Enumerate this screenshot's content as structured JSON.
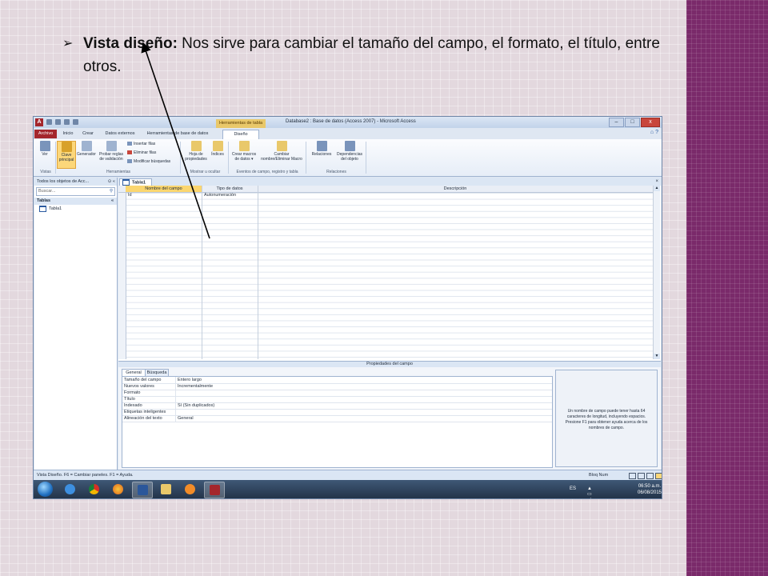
{
  "slide": {
    "bullet_symbol": "➢",
    "bullet_bold": "Vista diseño:",
    "bullet_text": " Nos sirve para cambiar el tamaño del campo, el formato, el título, entre otros."
  },
  "window": {
    "title": "Database2 : Base de datos (Access 2007) - Microsoft Access",
    "context_tab": "Herramientas de tabla",
    "app_icon": "A",
    "buttons": [
      "–",
      "□",
      "x"
    ]
  },
  "tabs": [
    "Archivo",
    "Inicio",
    "Crear",
    "Datos externos",
    "Herramientas de base de datos",
    "Diseño"
  ],
  "ribbon": {
    "ver": "Ver",
    "clave_principal": "Clave principal",
    "generador": "Generador",
    "probar_reglas": "Probar reglas de validación",
    "insertar_filas": "Insertar filas",
    "eliminar_filas": "Eliminar filas",
    "modificar_busquedas": "Modificar búsquedas",
    "hoja_propiedades": "Hoja de propiedades",
    "indices": "Índices",
    "crear_macros": "Crear macros de datos ▾",
    "cambiar_nombre": "Cambiar nombre/Eliminar Macro",
    "relaciones": "Relaciones",
    "dependencias": "Dependencias del objeto",
    "groups": [
      "Vistas",
      "Herramientas",
      "Mostrar u ocultar",
      "Eventos de campo, registro y tabla",
      "Relaciones"
    ]
  },
  "nav": {
    "header": "Todos los objetos de Acc...",
    "header_ctrl": "⊙ «",
    "search_placeholder": "Buscar...",
    "group": "Tablas",
    "group_chevron": "«",
    "items": [
      "Tabla1"
    ]
  },
  "document": {
    "tab": "Tabla1",
    "close": "×",
    "columns": [
      "Nombre del campo",
      "Tipo de datos",
      "Descripción"
    ],
    "rows": [
      {
        "name": "Id",
        "type": "Autonumeración",
        "description": ""
      }
    ],
    "key_symbol": "⚷"
  },
  "properties": {
    "title": "Propiedades del campo",
    "tabs": [
      "General",
      "Búsqueda"
    ],
    "rows": [
      {
        "label": "Tamaño del campo",
        "value": "Entero largo"
      },
      {
        "label": "Nuevos valores",
        "value": "Incrementalmente"
      },
      {
        "label": "Formato",
        "value": ""
      },
      {
        "label": "Título",
        "value": ""
      },
      {
        "label": "Indexado",
        "value": "Sí (Sin duplicados)"
      },
      {
        "label": "Etiquetas inteligentes",
        "value": ""
      },
      {
        "label": "Alineación del texto",
        "value": "General"
      }
    ],
    "help": "Un nombre de campo puede tener hasta 64 caracteres de longitud, incluyendo espacios. Presione F1 para obtener ayuda acerca de los nombres de campo."
  },
  "status": {
    "left": "Vista Diseño.  F6 = Cambiar paneles.  F1 = Ayuda.",
    "right": "Bloq Num"
  },
  "taskbar": {
    "lang": "ES",
    "tray_icons": "▲ ▭ ◢ ♪",
    "time": "06:50 a.m.",
    "date": "06/08/2015"
  },
  "colors": {
    "access_red": "#a4262c",
    "ribbon_highlight": "#fcd77a",
    "slide_band": "#7a2a6a"
  }
}
